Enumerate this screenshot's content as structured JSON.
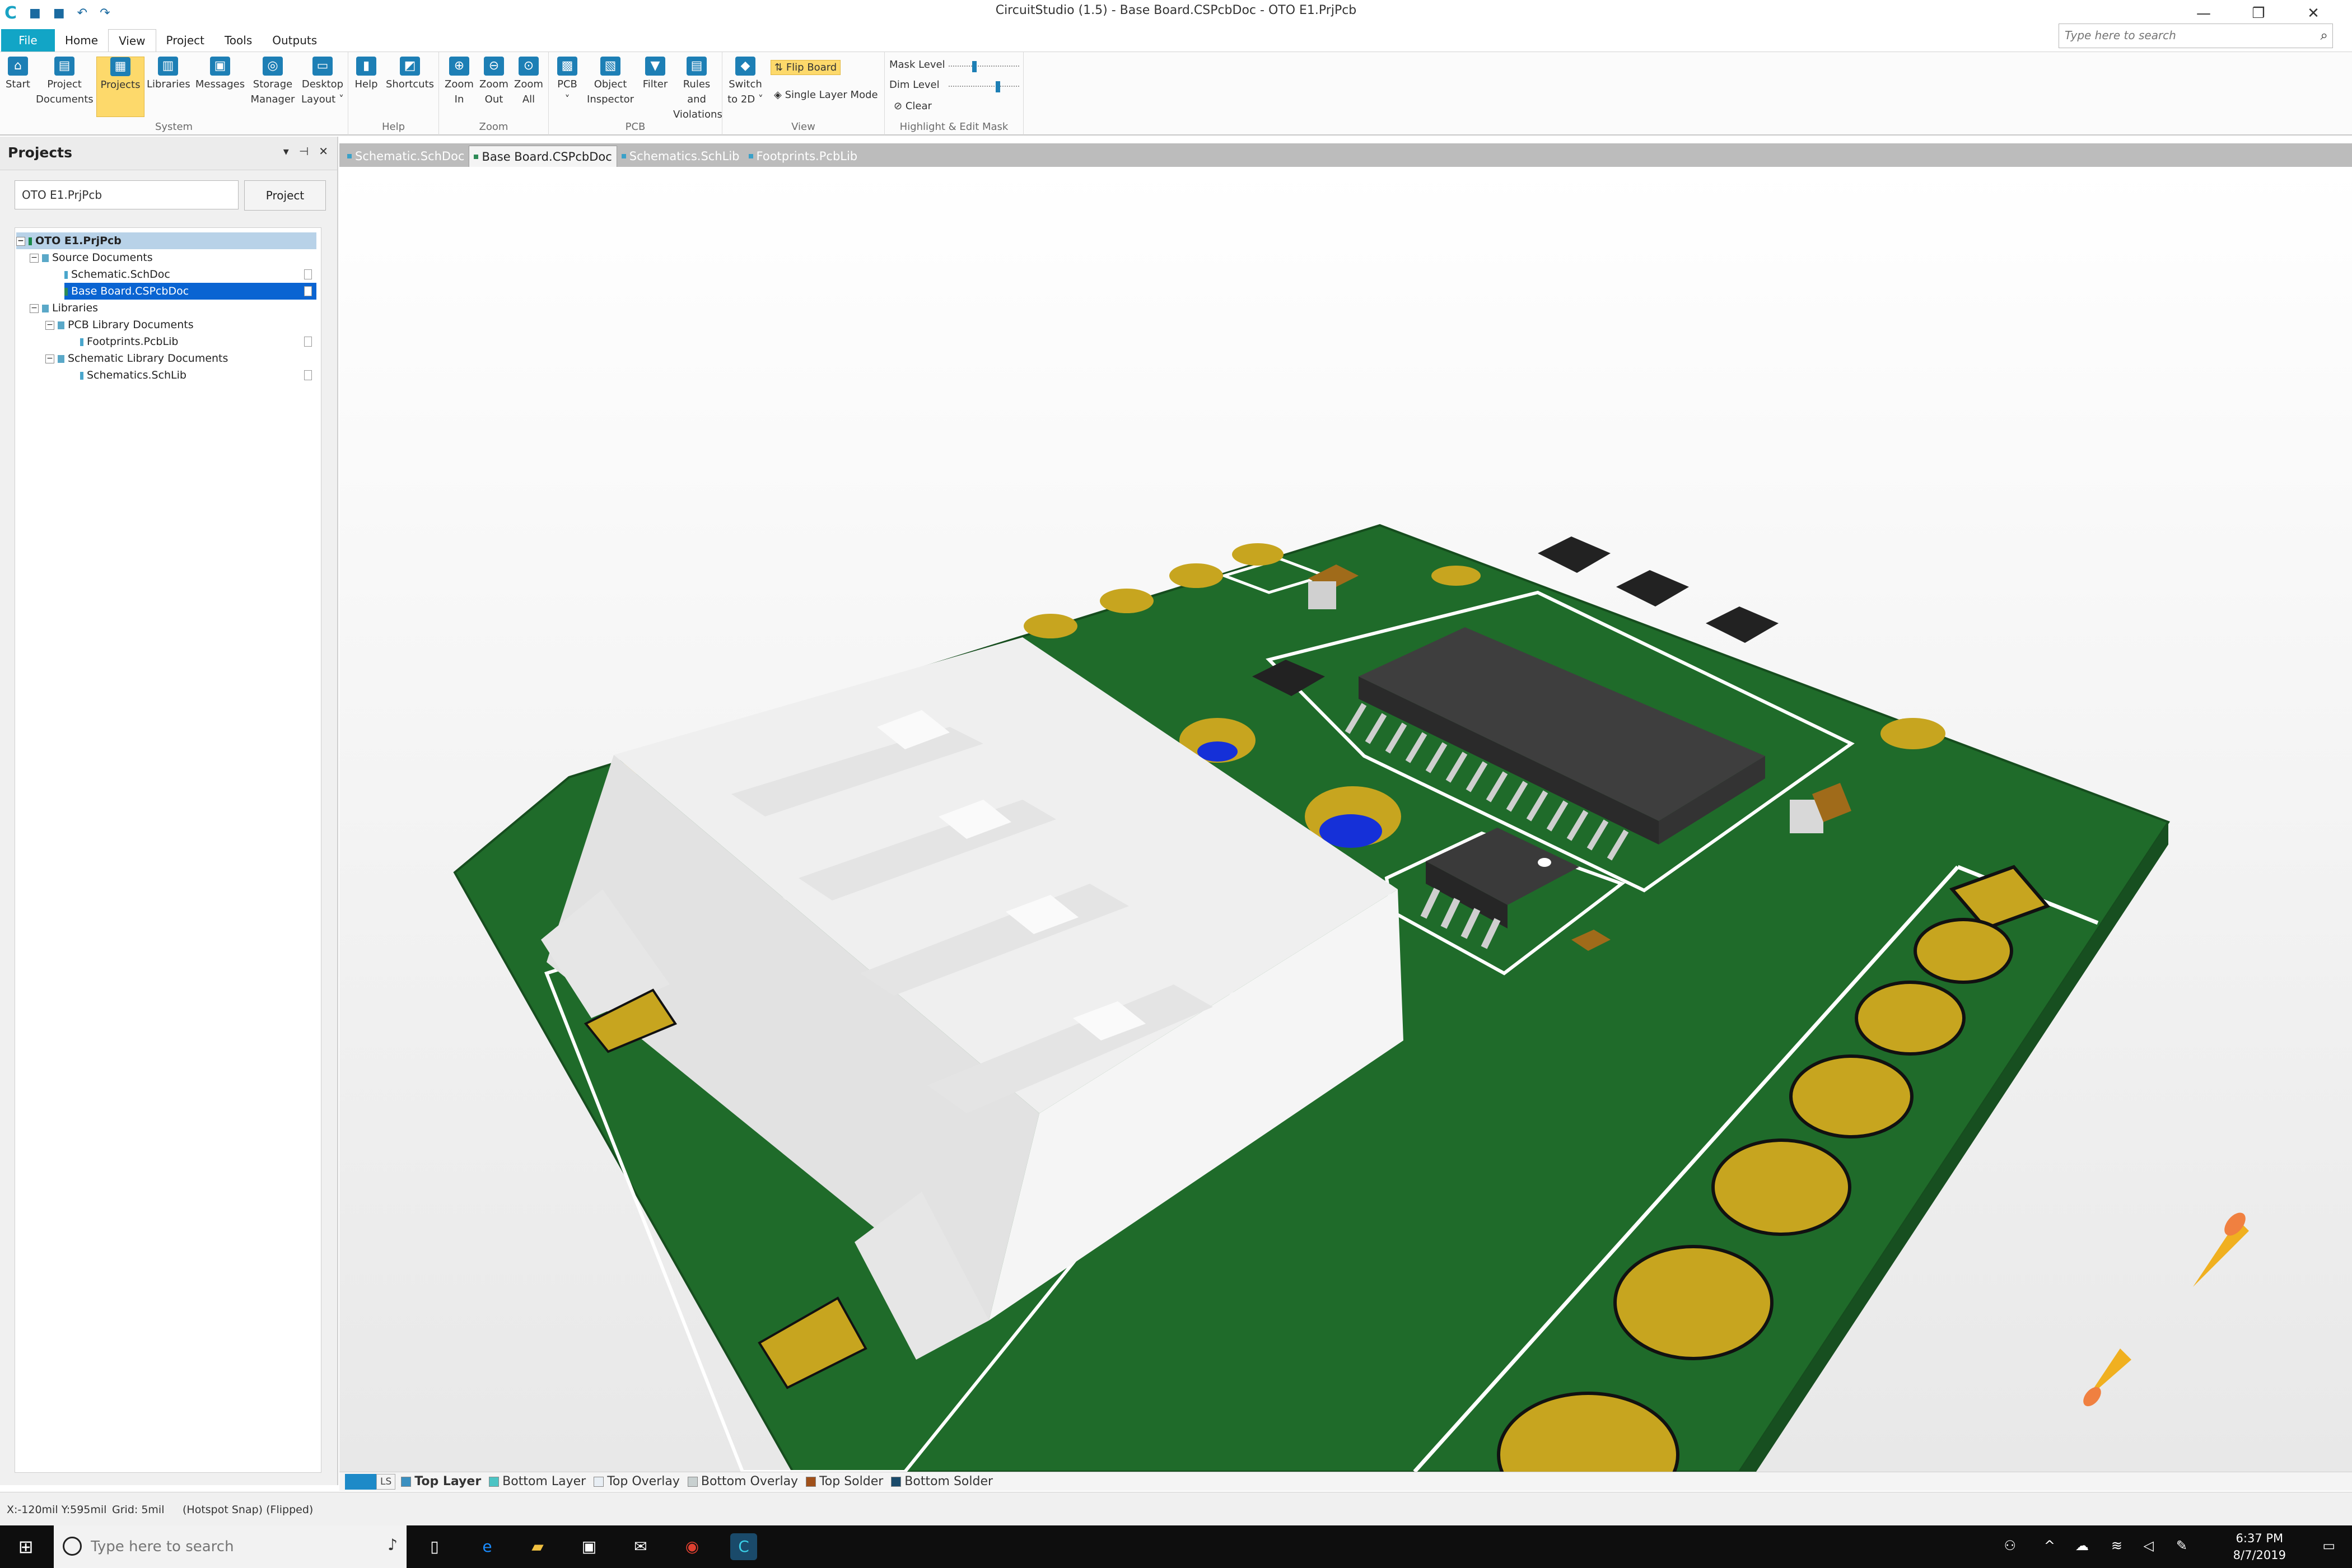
{
  "window": {
    "title": "CircuitStudio (1.5) - Base Board.CSPcbDoc - OTO E1.PrjPcb",
    "minimize": "—",
    "restore": "❐",
    "close": "✕"
  },
  "quick_access": {
    "logo": "C",
    "save": "■",
    "save_all": "■",
    "undo": "↶",
    "redo": "↷"
  },
  "ribbon_tabs": [
    "File",
    "Home",
    "View",
    "Project",
    "Tools",
    "Outputs"
  ],
  "active_ribbon_tab": "View",
  "search": {
    "placeholder": "Type here to search",
    "icon": "⌕"
  },
  "ribbon": {
    "groups": [
      {
        "name": "System"
      },
      {
        "name": "Help"
      },
      {
        "name": "Zoom"
      },
      {
        "name": "PCB"
      },
      {
        "name": "View"
      },
      {
        "name": "Highlight & Edit Mask"
      }
    ],
    "buttons": {
      "start": [
        "Start"
      ],
      "project_documents": [
        "Project",
        "Documents"
      ],
      "projects": [
        "Projects"
      ],
      "libraries": [
        "Libraries"
      ],
      "messages": [
        "Messages"
      ],
      "storage_manager": [
        "Storage",
        "Manager"
      ],
      "desktop_layout": [
        "Desktop",
        "Layout ˅"
      ],
      "help": [
        "Help"
      ],
      "shortcuts": [
        "Shortcuts"
      ],
      "zoom_in": [
        "Zoom",
        "In"
      ],
      "zoom_out": [
        "Zoom",
        "Out"
      ],
      "zoom_all": [
        "Zoom",
        "All"
      ],
      "pcb": [
        "PCB",
        "˅"
      ],
      "object_inspector": [
        "Object",
        "Inspector"
      ],
      "filter": [
        "Filter"
      ],
      "rules_violations": [
        "Rules and",
        "Violations"
      ],
      "switch_2d": [
        "Switch",
        "to 2D ˅"
      ]
    },
    "flip_board": "Flip Board",
    "single_layer_mode": "Single Layer Mode",
    "mask_level": "Mask Level",
    "dim_level": "Dim Level",
    "clear": "Clear"
  },
  "projects_panel": {
    "title": "Projects",
    "controls": [
      "▾",
      "⊣",
      "✕"
    ],
    "project_field": "OTO E1.PrjPcb",
    "project_button": "Project",
    "tree": {
      "root": "OTO E1.PrjPcb",
      "source_documents": "Source Documents",
      "schematic_doc": "Schematic.SchDoc",
      "base_board": "Base Board.CSPcbDoc",
      "libraries": "Libraries",
      "pcb_library_documents": "PCB Library Documents",
      "footprints": "Footprints.PcbLib",
      "schematic_library_documents": "Schematic Library Documents",
      "schematics_lib": "Schematics.SchLib"
    }
  },
  "document_tabs": [
    "Schematic.SchDoc",
    "Base Board.CSPcbDoc",
    "Schematics.SchLib",
    "Footprints.PcbLib"
  ],
  "active_document_tab": "Base Board.CSPcbDoc",
  "layers": {
    "ls_label": "LS",
    "tabs": [
      {
        "name": "Top Layer",
        "color": "#3a8fc0"
      },
      {
        "name": "Bottom Layer",
        "color": "#4cc4c4"
      },
      {
        "name": "Top Overlay",
        "color": "#e8eef4"
      },
      {
        "name": "Bottom Overlay",
        "color": "#c8d0d0"
      },
      {
        "name": "Top Solder",
        "color": "#a0501a"
      },
      {
        "name": "Bottom Solder",
        "color": "#1a4a6a"
      }
    ]
  },
  "status": {
    "coords": "X:-120mil Y:595mil",
    "grid": "Grid: 5mil",
    "snap": "(Hotspot Snap) (Flipped)"
  },
  "taskbar": {
    "search_placeholder": "Type here to search",
    "time": "6:37 PM",
    "date": "8/7/2019"
  },
  "colors": {
    "accent": "#12a5c6",
    "board_green": "#1f6b2a",
    "pad_gold": "#c7a51f",
    "selection": "#0a64d2",
    "highlight": "#fdd96b"
  }
}
